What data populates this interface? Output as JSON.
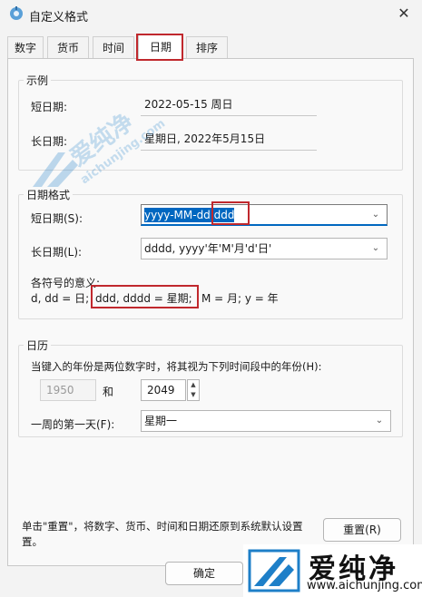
{
  "window": {
    "title": "自定义格式",
    "icon": "settings-window-icon",
    "close_icon": "close-icon"
  },
  "tabs": [
    "数字",
    "货币",
    "时间",
    "日期",
    "排序"
  ],
  "example": {
    "legend": "示例",
    "short_label": "短日期:",
    "short_value": "2022-05-15 周日",
    "long_label": "长日期:",
    "long_value": "星期日, 2022年5月15日"
  },
  "date_format": {
    "legend": "日期格式",
    "short_label": "短日期(S):",
    "short_value_main": "yyyy-MM-dd",
    "short_value_extra": " ddd",
    "long_label": "长日期(L):",
    "long_value": "dddd, yyyy'年'M'月'd'日'",
    "symbols_title": "各符号的意义:",
    "symbols_part1": "d, dd = 日;",
    "symbols_part2": "ddd, dddd = 星期;",
    "symbols_part3": "M = 月; y = 年"
  },
  "calendar": {
    "legend": "日历",
    "two_digit_text": "当键入的年份是两位数字时，将其视为下列时间段中的年份(H):",
    "from_year": "1950",
    "and_text": "和",
    "to_year": "2049",
    "first_day_label": "一周的第一天(F):",
    "first_day_value": "星期一"
  },
  "footer": {
    "reset_text_line1": "单击\"重置\"，将数字、货币、时间和日期还原到系统默认设置",
    "reset_text_line2": "置。",
    "reset_button": "重置(R)",
    "ok_button": "确定"
  },
  "watermark": {
    "center_brand": "爱纯净",
    "center_url": "aichunjing.com",
    "corner_brand": "爱纯净",
    "corner_url": "www.aichunjing.com"
  },
  "colors": {
    "accent": "#0067c0",
    "highlight_box": "#c0282d",
    "watermark": "#1e7fc8"
  }
}
